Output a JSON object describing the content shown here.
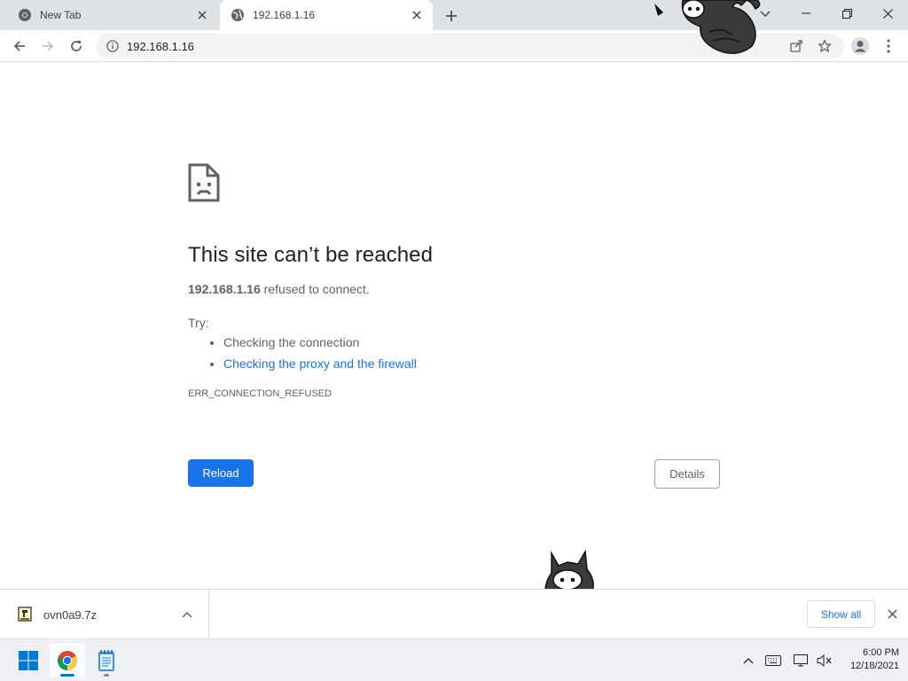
{
  "browser": {
    "tabs": [
      {
        "title": "New Tab",
        "active": false,
        "favicon": "chrome-icon"
      },
      {
        "title": "192.168.1.16",
        "active": true,
        "favicon": "globe-icon"
      }
    ],
    "address_bar": {
      "url": "192.168.1.16"
    }
  },
  "error_page": {
    "heading": "This site can’t be reached",
    "host": "192.168.1.16",
    "description_suffix": " refused to connect.",
    "try_label": "Try:",
    "suggestions": [
      {
        "text": "Checking the connection",
        "link": false
      },
      {
        "text": "Checking the proxy and the firewall",
        "link": true
      }
    ],
    "error_code": "ERR_CONNECTION_REFUSED",
    "reload_label": "Reload",
    "details_label": "Details"
  },
  "download_shelf": {
    "filename": "ovn0a9.7z",
    "show_all_label": "Show all"
  },
  "taskbar": {
    "time": "6:00 PM",
    "date": "12/18/2021"
  },
  "colors": {
    "accent": "#1a73e8",
    "tabstrip": "#dee1e6",
    "taskbar": "#eef0f4"
  }
}
